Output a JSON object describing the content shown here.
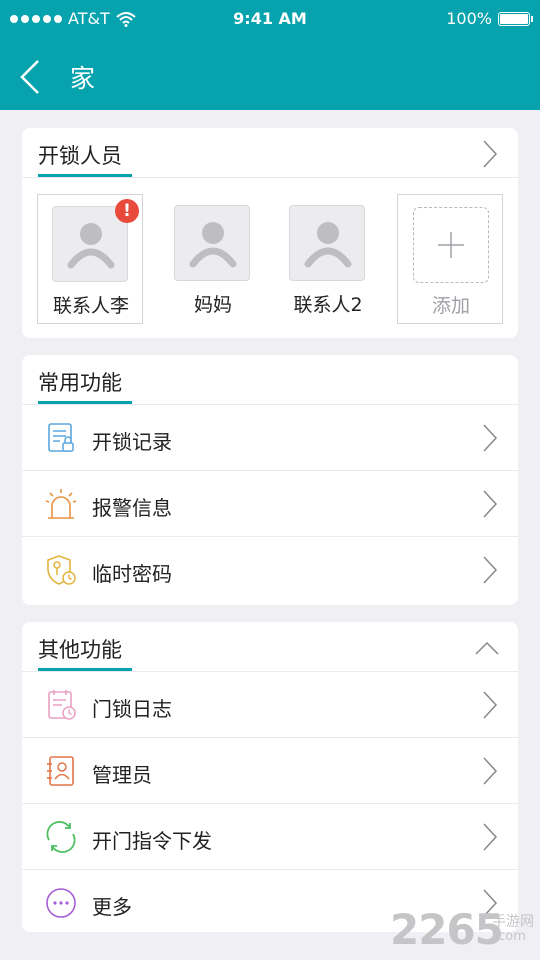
{
  "status_bar": {
    "carrier": "AT&T",
    "time": "9:41 AM",
    "battery": "100%",
    "wifi_icon": "wifi-icon",
    "battery_icon": "battery-icon"
  },
  "nav": {
    "title": "家",
    "back_icon": "back-arrow-icon"
  },
  "unlock_people": {
    "title": "开锁人员",
    "contacts": [
      {
        "name": "联系人李",
        "badge": "!"
      },
      {
        "name": "妈妈"
      },
      {
        "name": "联系人2"
      }
    ],
    "add_label": "添加"
  },
  "common_functions": {
    "title": "常用功能",
    "items": [
      {
        "label": "开锁记录",
        "icon": "unlock-record-icon"
      },
      {
        "label": "报警信息",
        "icon": "alarm-icon"
      },
      {
        "label": "临时密码",
        "icon": "temp-password-icon"
      }
    ]
  },
  "other_functions": {
    "title": "其他功能",
    "items": [
      {
        "label": "门锁日志",
        "icon": "lock-log-icon"
      },
      {
        "label": "管理员",
        "icon": "admin-icon"
      },
      {
        "label": "开门指令下发",
        "icon": "sync-command-icon"
      },
      {
        "label": "更多",
        "icon": "more-icon"
      }
    ]
  },
  "watermark": {
    "number": "2265",
    "chinese": "手游网",
    "url": ".com"
  },
  "colors": {
    "accent": "#06a3ae",
    "badge": "#e84a3c",
    "background": "#f0f0f4"
  }
}
